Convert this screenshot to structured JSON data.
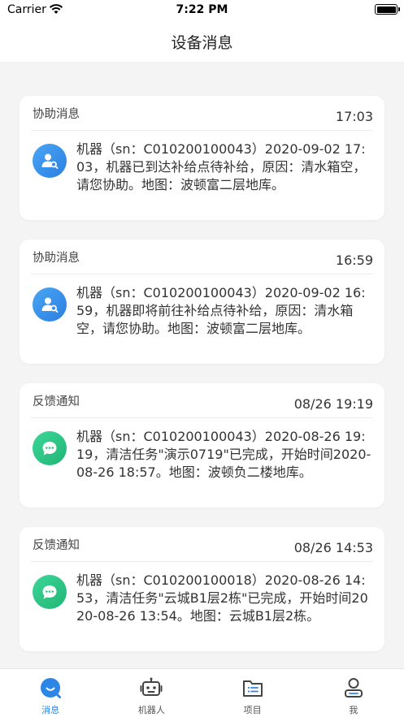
{
  "status_bar": {
    "carrier": "Carrier",
    "time": "7:22 PM"
  },
  "header": {
    "title": "设备消息"
  },
  "messages": [
    {
      "type": "协助消息",
      "time": "17:03",
      "icon": "user-search-icon",
      "color": "#3a93ee",
      "text": "机器（sn：C010200100043）2020-09-02 17:03，机器已到达补给点待补给，原因：清水箱空，请您协助。地图：波顿富二层地库。"
    },
    {
      "type": "协助消息",
      "time": "16:59",
      "icon": "user-search-icon",
      "color": "#3a93ee",
      "text": "机器（sn：C010200100043）2020-09-02 16:59，机器即将前往补给点待补给，原因：清水箱空，请您协助。地图：波顿富二层地库。"
    },
    {
      "type": "反馈通知",
      "time": "08/26 19:19",
      "icon": "chat-bubble-icon",
      "color": "#2cc584",
      "text": "机器（sn：C010200100043）2020-08-26 19:19，清洁任务\"演示0719\"已完成，开始时间2020-08-26 18:57。地图：波顿负二楼地库。"
    },
    {
      "type": "反馈通知",
      "time": "08/26 14:53",
      "icon": "chat-bubble-icon",
      "color": "#2cc584",
      "text": "机器（sn：C010200100018）2020-08-26 14:53，清洁任务\"云城B1层2栋\"已完成，开始时间2020-08-26 13:54。地图：云城B1层2栋。"
    }
  ],
  "tabbar": {
    "items": [
      {
        "label": "消息",
        "icon": "message-icon",
        "active": true
      },
      {
        "label": "机器人",
        "icon": "robot-icon",
        "active": false
      },
      {
        "label": "项目",
        "icon": "folder-list-icon",
        "active": false
      },
      {
        "label": "我",
        "icon": "person-icon",
        "active": false
      }
    ],
    "active_color": "#2b86e6",
    "inactive_color": "#555555"
  }
}
